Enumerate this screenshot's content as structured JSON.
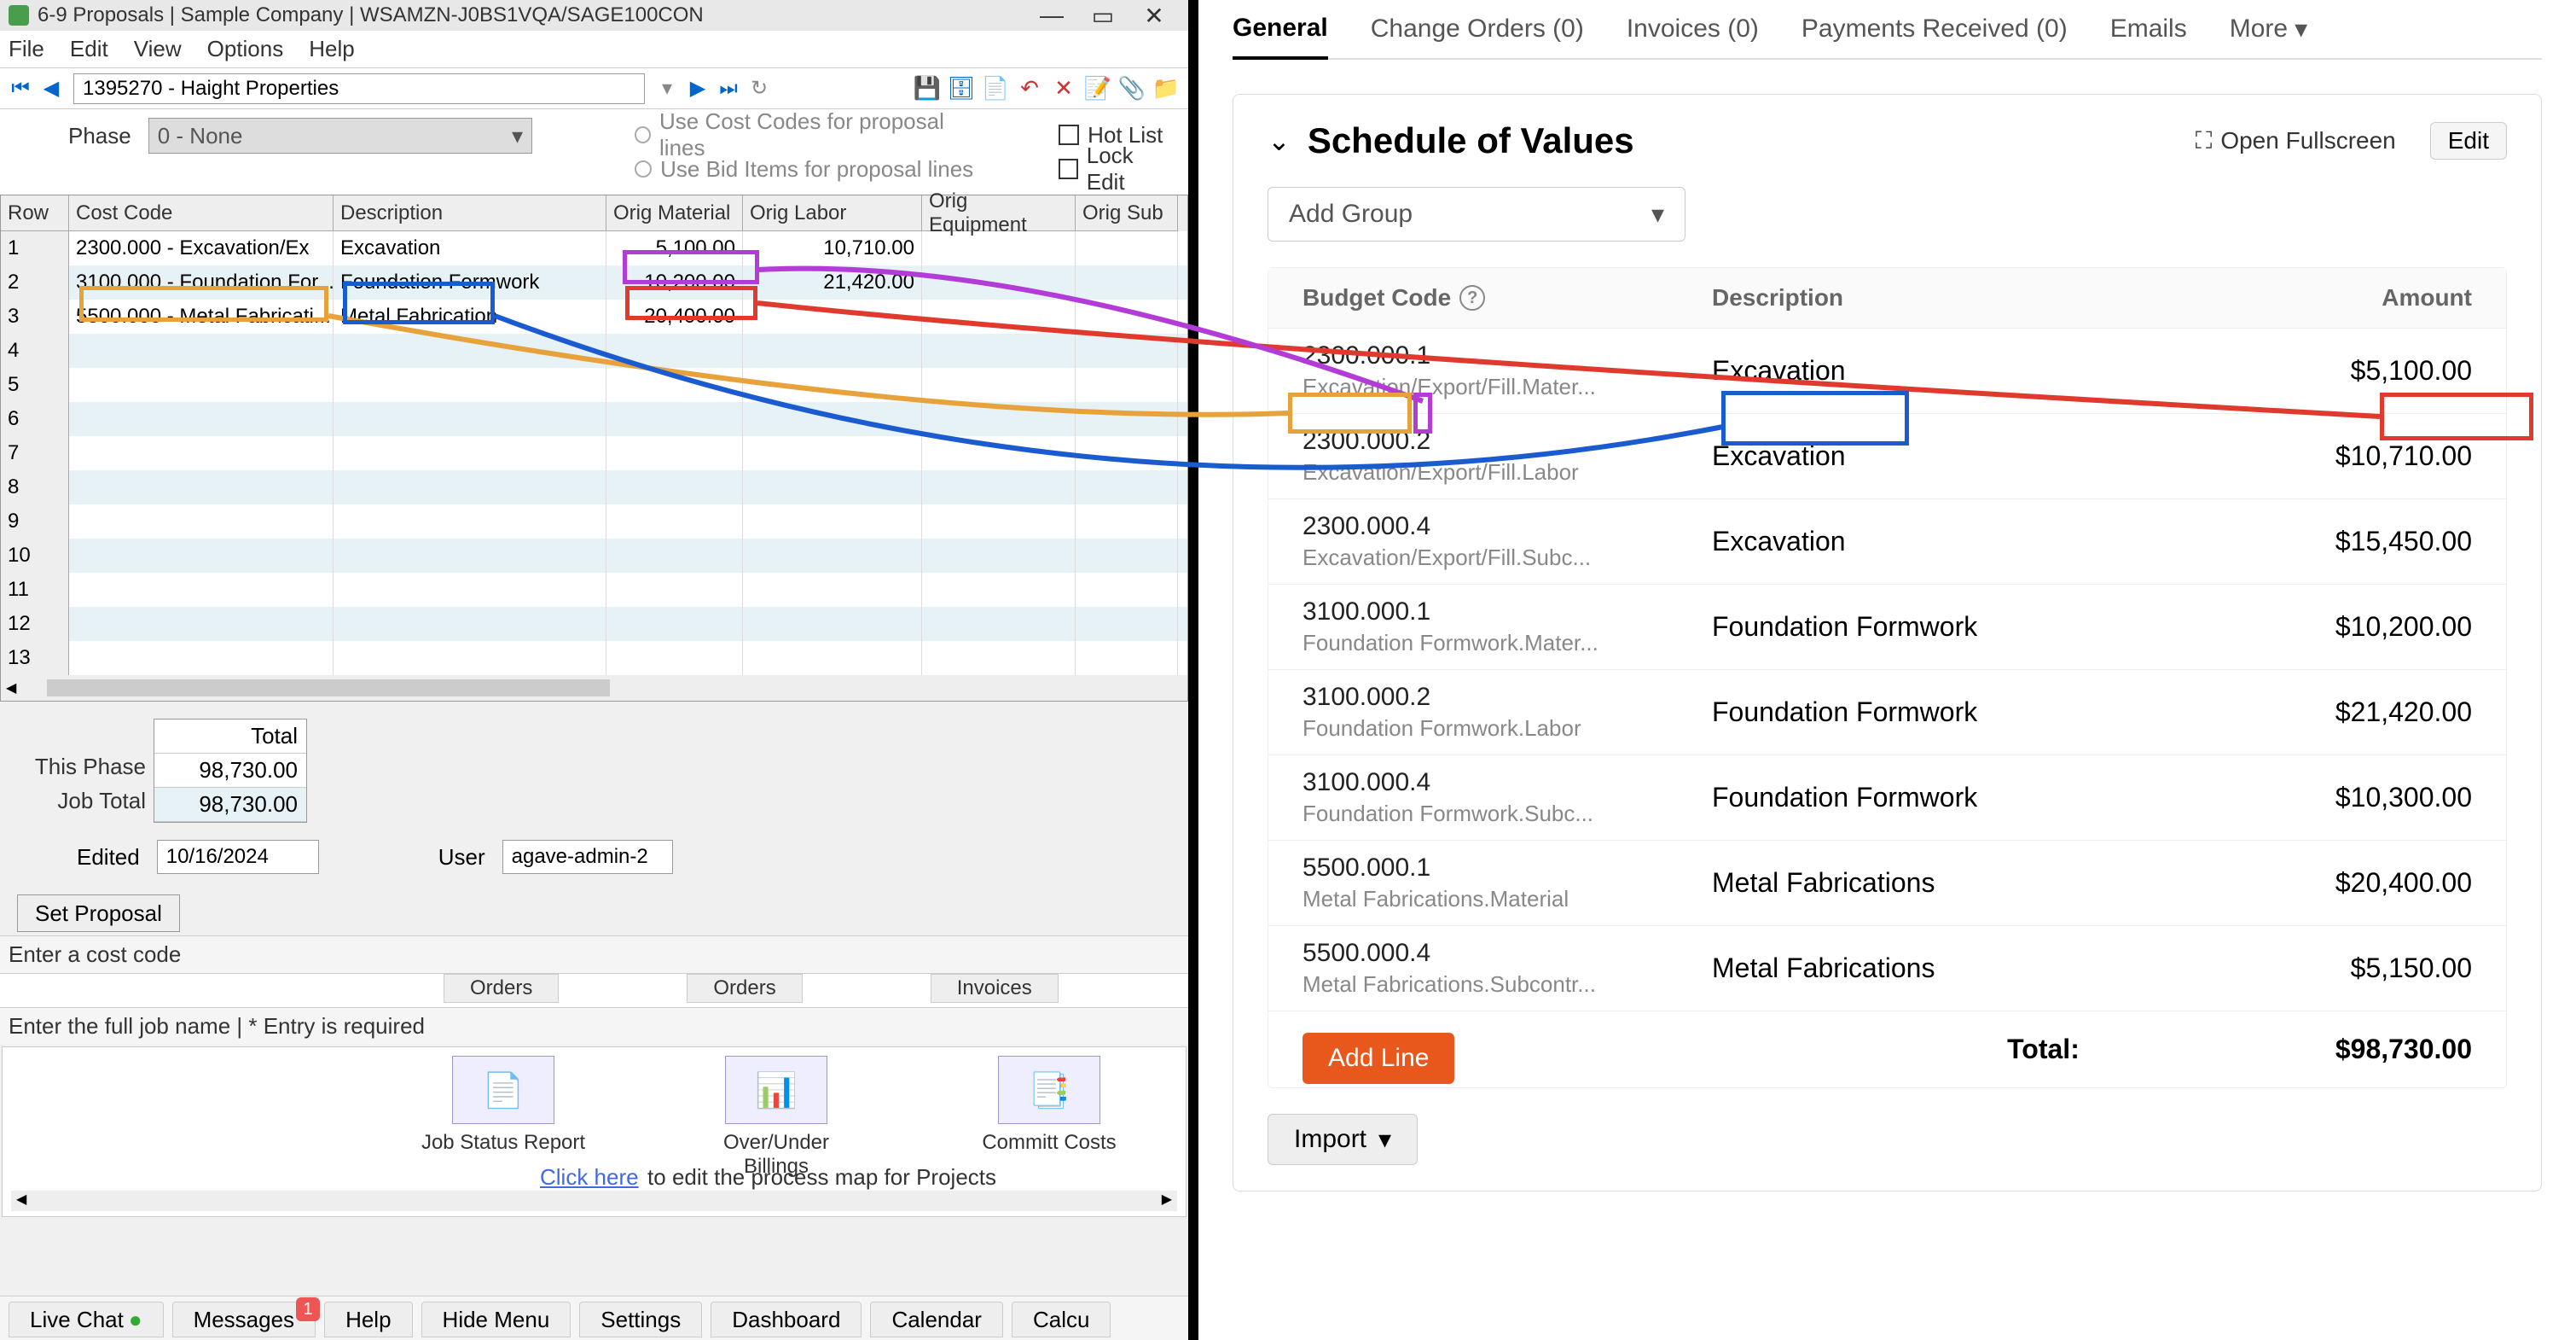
{
  "left": {
    "titlebar": "6-9 Proposals  |  Sample Company  |  WSAMZN-J0BS1VQA/SAGE100CON",
    "menus": {
      "file": "File",
      "edit": "Edit",
      "view": "View",
      "options": "Options",
      "help": "Help"
    },
    "job_field": "1395270 - Haight Properties",
    "phase_label": "Phase",
    "phase_value": "0 - None",
    "radio1": "Use Cost Codes for proposal lines",
    "radio2": "Use Bid Items for proposal lines",
    "check_hot": "Hot List",
    "check_lock": "Lock Edit",
    "grid": {
      "headers": {
        "row": "Row",
        "cost": "Cost Code",
        "desc": "Description",
        "mat": "Orig Material",
        "lab": "Orig Labor",
        "equip": "Orig Equipment",
        "sub": "Orig Sub"
      },
      "rows": [
        {
          "n": "1",
          "cost": "2300.000 - Excavation/Ex",
          "desc": "Excavation",
          "mat": "5,100.00",
          "lab": "10,710.00",
          "equip": "",
          "sub": ""
        },
        {
          "n": "2",
          "cost": "3100.000 - Foundation For...",
          "desc": "Foundation Formwork",
          "mat": "10,200.00",
          "lab": "21,420.00",
          "equip": "",
          "sub": ""
        },
        {
          "n": "3",
          "cost": "5500.000 - Metal Fabricati...",
          "desc": "Metal Fabrication",
          "mat": "20,400.00",
          "lab": "",
          "equip": "",
          "sub": ""
        }
      ],
      "blank": [
        "4",
        "5",
        "6",
        "7",
        "8",
        "9",
        "10",
        "11",
        "12",
        "13"
      ]
    },
    "totals": {
      "head": "Total",
      "this_phase_lbl": "This Phase",
      "this_phase": "98,730.00",
      "job_total_lbl": "Job Total",
      "job_total": "98,730.00"
    },
    "edited_lbl": "Edited",
    "edited": "10/16/2024",
    "user_lbl": "User",
    "user": "agave-admin-2",
    "set_proposal": "Set Proposal",
    "status1": "Enter a cost code",
    "status2": "Enter the full job name   |   * Entry is required",
    "top_tiles": {
      "orders1": "Orders",
      "orders2": "Orders",
      "invoices": "Invoices"
    },
    "pm": {
      "t1": "Job Status Report",
      "t2": "Over/Under Billings",
      "t3": "Committ Costs",
      "link": "Click here",
      "text": " to edit the process map for Projects"
    },
    "bottom": {
      "live": "Live Chat",
      "msg": "Messages",
      "msg_badge": "1",
      "help": "Help",
      "hide": "Hide Menu",
      "settings": "Settings",
      "dash": "Dashboard",
      "cal": "Calendar",
      "calc": "Calcu"
    }
  },
  "right": {
    "tabs": {
      "general": "General",
      "co": "Change Orders (0)",
      "inv": "Invoices (0)",
      "pay": "Payments Received (0)",
      "emails": "Emails",
      "more": "More"
    },
    "sov": {
      "title": "Schedule of Values",
      "fullscreen": "Open Fullscreen",
      "edit": "Edit",
      "add_group": "Add Group",
      "th": {
        "budget": "Budget Code",
        "desc": "Description",
        "amount": "Amount"
      },
      "rows": [
        {
          "code": "2300.000.1",
          "sub": "Excavation/Export/Fill.Mater...",
          "desc": "Excavation",
          "amt": "$5,100.00"
        },
        {
          "code": "2300.000.2",
          "sub": "Excavation/Export/Fill.Labor",
          "desc": "Excavation",
          "amt": "$10,710.00"
        },
        {
          "code": "2300.000.4",
          "sub": "Excavation/Export/Fill.Subc...",
          "desc": "Excavation",
          "amt": "$15,450.00"
        },
        {
          "code": "3100.000.1",
          "sub": "Foundation Formwork.Mater...",
          "desc": "Foundation Formwork",
          "amt": "$10,200.00"
        },
        {
          "code": "3100.000.2",
          "sub": "Foundation Formwork.Labor",
          "desc": "Foundation Formwork",
          "amt": "$21,420.00"
        },
        {
          "code": "3100.000.4",
          "sub": "Foundation Formwork.Subc...",
          "desc": "Foundation Formwork",
          "amt": "$10,300.00"
        },
        {
          "code": "5500.000.1",
          "sub": "Metal Fabrications.Material",
          "desc": "Metal Fabrications",
          "amt": "$20,400.00"
        },
        {
          "code": "5500.000.4",
          "sub": "Metal Fabrications.Subcontr...",
          "desc": "Metal Fabrications",
          "amt": "$5,150.00"
        }
      ],
      "total_lbl": "Total:",
      "total": "$98,730.00",
      "add_line": "Add Line",
      "import": "Import"
    }
  }
}
